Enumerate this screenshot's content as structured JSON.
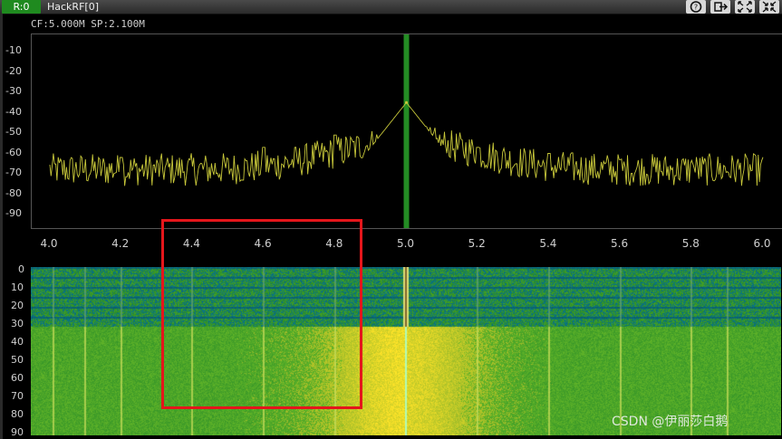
{
  "window": {
    "receiver_badge": "R:0",
    "device_title": "HackRF[0]",
    "icons": [
      "help-icon",
      "export-icon",
      "expand-icon",
      "collapse-icon"
    ]
  },
  "spectrum": {
    "info_text": "CF:5.000M SP:2.100M",
    "y_ticks": [
      "-10",
      "-20",
      "-30",
      "-40",
      "-50",
      "-60",
      "-70",
      "-80",
      "-90"
    ],
    "x_ticks": [
      "4.0",
      "4.2",
      "4.4",
      "4.6",
      "4.8",
      "5.0",
      "5.2",
      "5.4",
      "5.6",
      "5.8",
      "6.0"
    ],
    "trace_color": "#c8c83a",
    "marker_color": "#2aa52a"
  },
  "waterfall": {
    "y_ticks": [
      "0",
      "10",
      "20",
      "30",
      "40",
      "50",
      "60",
      "70",
      "80",
      "90"
    ]
  },
  "chart_data": {
    "type": "line",
    "x_range": [
      4.0,
      6.0
    ],
    "y_range": [
      -100,
      0
    ],
    "center_frequency": 5.0,
    "span": 2.1,
    "noise_floor": -68,
    "peak": {
      "x": 5.0,
      "y": -35
    },
    "spurs": [
      {
        "x": 4.2,
        "y": -62
      },
      {
        "x": 4.6,
        "y": -57
      },
      {
        "x": 4.8,
        "y": -51
      },
      {
        "x": 5.2,
        "y": -57
      },
      {
        "x": 5.4,
        "y": -60
      },
      {
        "x": 5.6,
        "y": -63
      },
      {
        "x": 5.8,
        "y": -65
      }
    ]
  },
  "annotation": {
    "highlight_color": "#e4161b"
  },
  "watermark": "CSDN @伊丽莎白鹅"
}
